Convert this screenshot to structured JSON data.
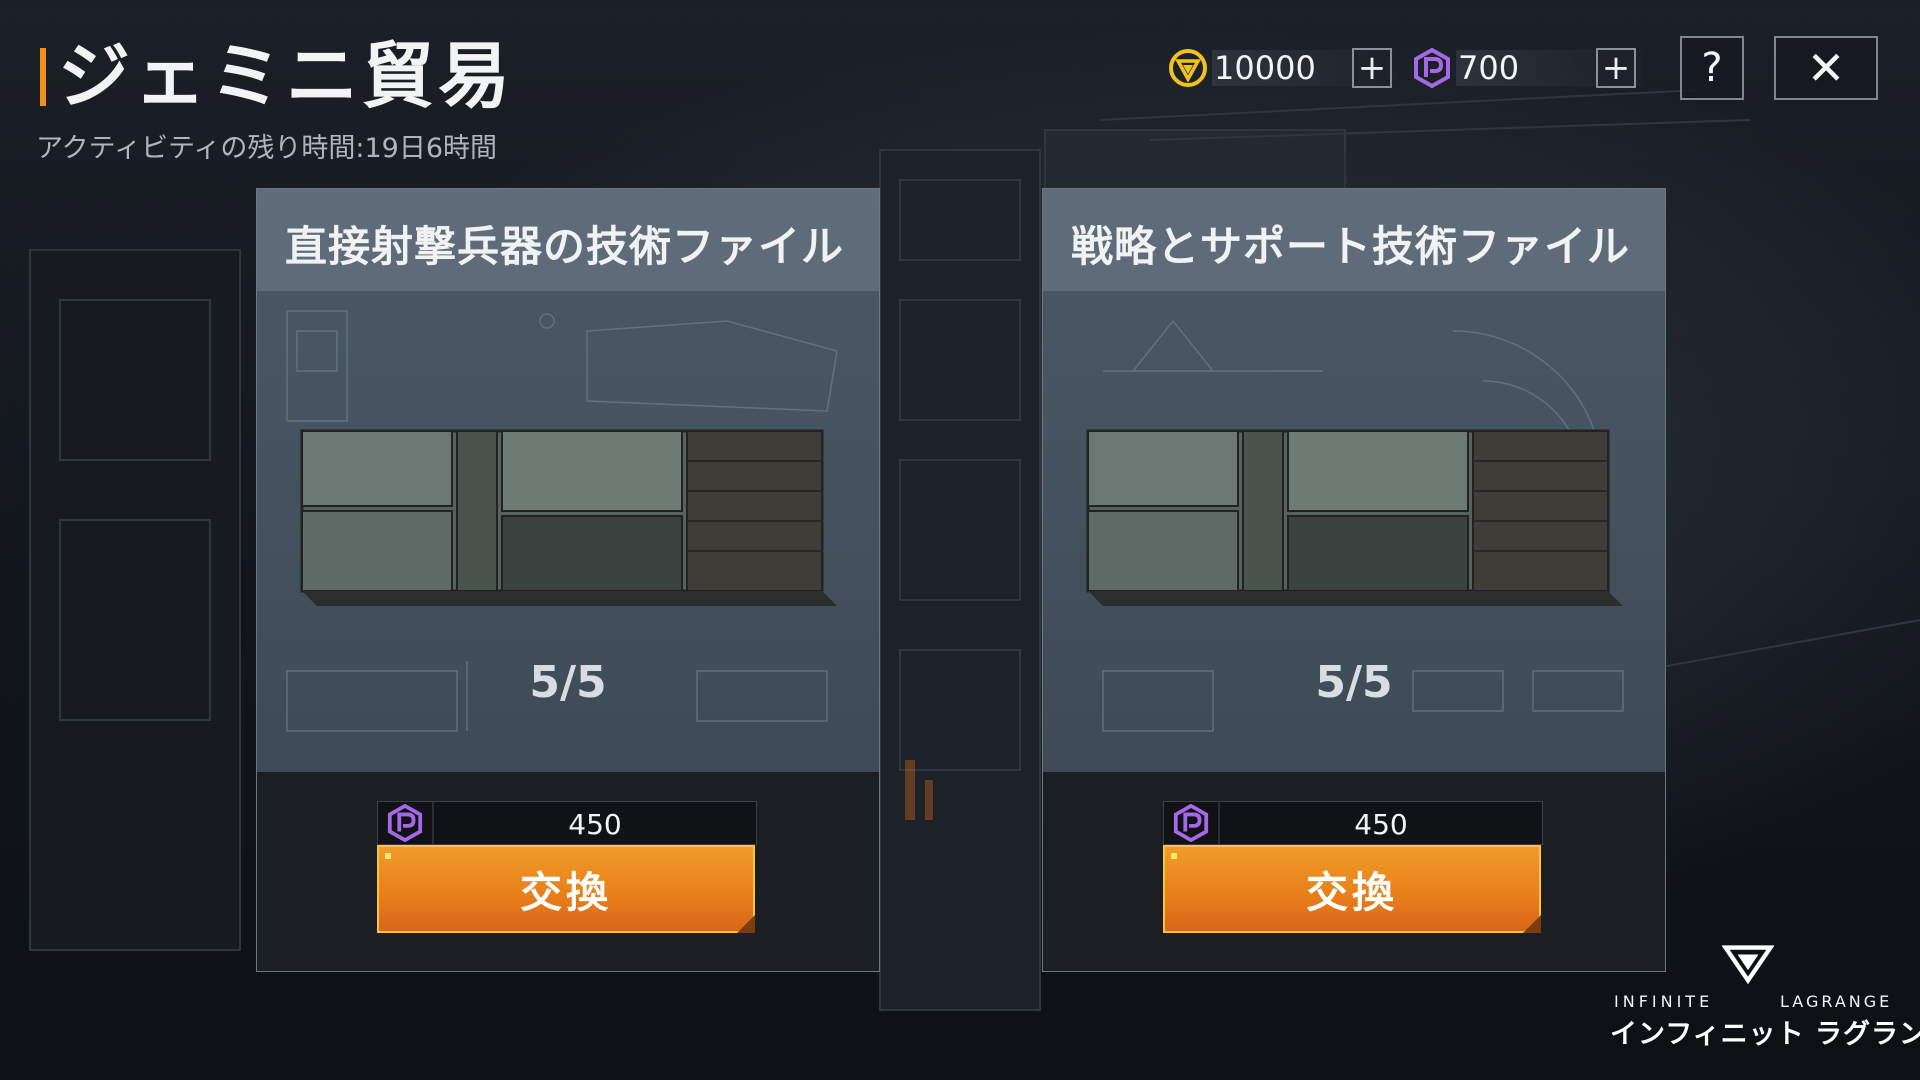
{
  "header": {
    "title": "ジェミニ貿易",
    "subtitle": "アクティビティの残り時間:19日6時間"
  },
  "currencies": [
    {
      "name": "gold-coin",
      "icon": "gold-triangle-coin-icon",
      "value": "10000",
      "color": "#f2c21c"
    },
    {
      "name": "purple-token",
      "icon": "purple-p-token-icon",
      "value": "700",
      "color": "#a568e8"
    }
  ],
  "top_buttons": {
    "help_label": "?",
    "close_label": "✕"
  },
  "cards": [
    {
      "title": "直接射撃兵器の技術ファイル",
      "stock": "5/5",
      "price": "450",
      "currency_icon": "purple-p-token-icon",
      "button_label": "交換"
    },
    {
      "title": "戦略とサポート技術ファイル",
      "stock": "5/5",
      "price": "450",
      "currency_icon": "purple-p-token-icon",
      "button_label": "交換"
    }
  ],
  "logo": {
    "en_left": "INFINITE",
    "en_right": "LAGRANGE",
    "jp": "インフィニット ラグランジュ"
  },
  "colors": {
    "accent_orange": "#f0931c",
    "button_gold_border": "#f7c542",
    "card_panel": "#3e4b57"
  }
}
